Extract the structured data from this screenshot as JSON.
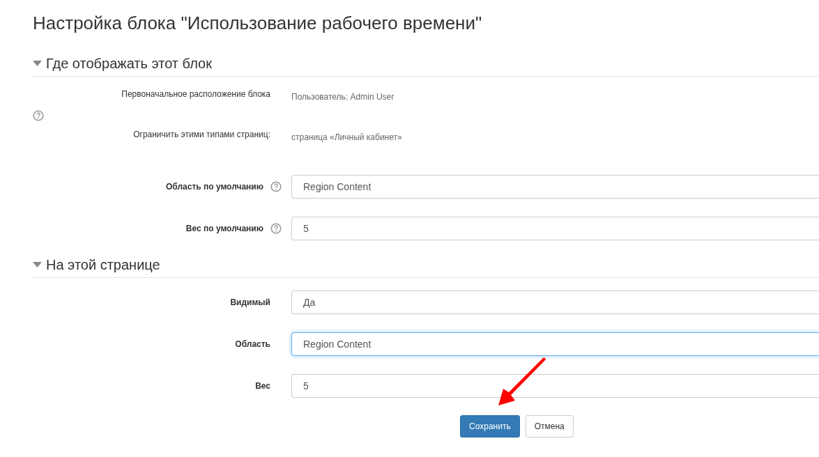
{
  "title": "Настройка блока \"Использование рабочего времени\"",
  "sections": [
    {
      "heading": "Где отображать этот блок",
      "expanded": true,
      "help_icon": true,
      "static_rows": [
        {
          "label": "Первоначальное расположение блока",
          "value": "Пользователь: Admin User"
        },
        {
          "label": "Ограничить этими типами страниц:",
          "value": "страница «Личный кабинет»"
        }
      ],
      "fields": [
        {
          "label": "Область по умолчанию",
          "help": true,
          "value": "Region Content",
          "focused": false
        },
        {
          "label": "Вес по умолчанию",
          "help": true,
          "value": "5",
          "focused": false
        }
      ]
    },
    {
      "heading": "На этой странице",
      "expanded": true,
      "fields": [
        {
          "label": "Видимый",
          "help": false,
          "value": "Да",
          "focused": false
        },
        {
          "label": "Область",
          "help": false,
          "value": "Region Content",
          "focused": true
        },
        {
          "label": "Вес",
          "help": false,
          "value": "5",
          "focused": false
        }
      ]
    }
  ],
  "buttons": [
    {
      "label": "Сохранить",
      "kind": "primary"
    },
    {
      "label": "Отмена",
      "kind": "default"
    }
  ]
}
